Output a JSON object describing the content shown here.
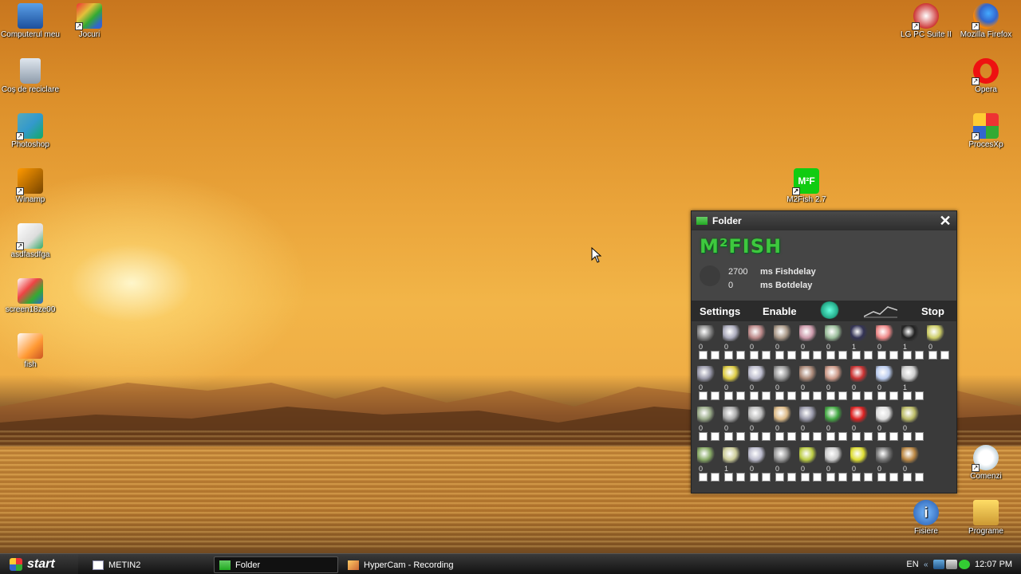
{
  "desktop": {
    "left_icons": [
      {
        "label": "Computerul meu",
        "icon": "computer-icon"
      },
      {
        "label": "Jocuri",
        "icon": "games-icon"
      },
      {
        "label": "Coș de reciclare",
        "icon": "recycle-bin-icon"
      },
      {
        "label": "Photoshop",
        "icon": "photoshop-icon"
      },
      {
        "label": "Winamp",
        "icon": "winamp-icon"
      },
      {
        "label": "asdfasdfga",
        "icon": "file-icon"
      },
      {
        "label": "screen18ze00",
        "icon": "image-file-icon"
      },
      {
        "label": "fish",
        "icon": "fish-file-icon"
      }
    ],
    "right_icons": [
      {
        "label": "LG PC Suite II",
        "icon": "lg-pc-suite-icon"
      },
      {
        "label": "Mozilla Firefox",
        "icon": "firefox-icon"
      },
      {
        "label": "Opera",
        "icon": "opera-icon"
      },
      {
        "label": "ProcesXp",
        "icon": "procesxp-icon"
      },
      {
        "label": "M2Fish 2.7",
        "icon": "m2fish-icon"
      },
      {
        "label": "Comenzi",
        "icon": "comenzi-icon"
      },
      {
        "label": "Fisiere",
        "icon": "fisiere-icon"
      },
      {
        "label": "Programe",
        "icon": "programe-icon"
      }
    ]
  },
  "window": {
    "title": "Folder",
    "close_glyph": "✕",
    "logo": "M²FISH",
    "fishdelay_value": "2700",
    "fishdelay_label": "ms Fishdelay",
    "botdelay_value": "0",
    "botdelay_label": "ms Botdelay",
    "menu": {
      "settings": "Settings",
      "enable": "Enable",
      "stop": "Stop"
    },
    "rows": [
      {
        "counts": [
          "0",
          "0",
          "0",
          "0",
          "0",
          "0",
          "1",
          "0",
          "1",
          "0"
        ],
        "colors": [
          "#888",
          "#aab",
          "#b88",
          "#a98",
          "#c9a",
          "#9b9",
          "#335",
          "#e88",
          "#222",
          "#cc6"
        ]
      },
      {
        "counts": [
          "0",
          "0",
          "0",
          "0",
          "0",
          "0",
          "0",
          "0",
          "1"
        ],
        "colors": [
          "#99a",
          "#dc4",
          "#bbc",
          "#999",
          "#a87",
          "#c98",
          "#c33",
          "#bce",
          "#ccc"
        ]
      },
      {
        "counts": [
          "0",
          "0",
          "0",
          "0",
          "0",
          "0",
          "0",
          "0",
          "0"
        ],
        "colors": [
          "#9a8",
          "#aaa",
          "#bbb",
          "#db8",
          "#99a",
          "#4a4",
          "#d22",
          "#ddd",
          "#bb6"
        ]
      },
      {
        "counts": [
          "0",
          "1",
          "0",
          "0",
          "0",
          "0",
          "0",
          "0",
          "0"
        ],
        "colors": [
          "#8a6",
          "#cc9",
          "#bbc",
          "#999",
          "#bc4",
          "#ccc",
          "#dd3",
          "#777",
          "#b84"
        ]
      }
    ]
  },
  "taskbar": {
    "start_label": "start",
    "tasks": [
      {
        "label": "METIN2",
        "active": false
      },
      {
        "label": "Folder",
        "active": true
      },
      {
        "label": "HyperCam - Recording",
        "active": false
      }
    ],
    "language": "EN",
    "clock": "12:07 PM"
  }
}
